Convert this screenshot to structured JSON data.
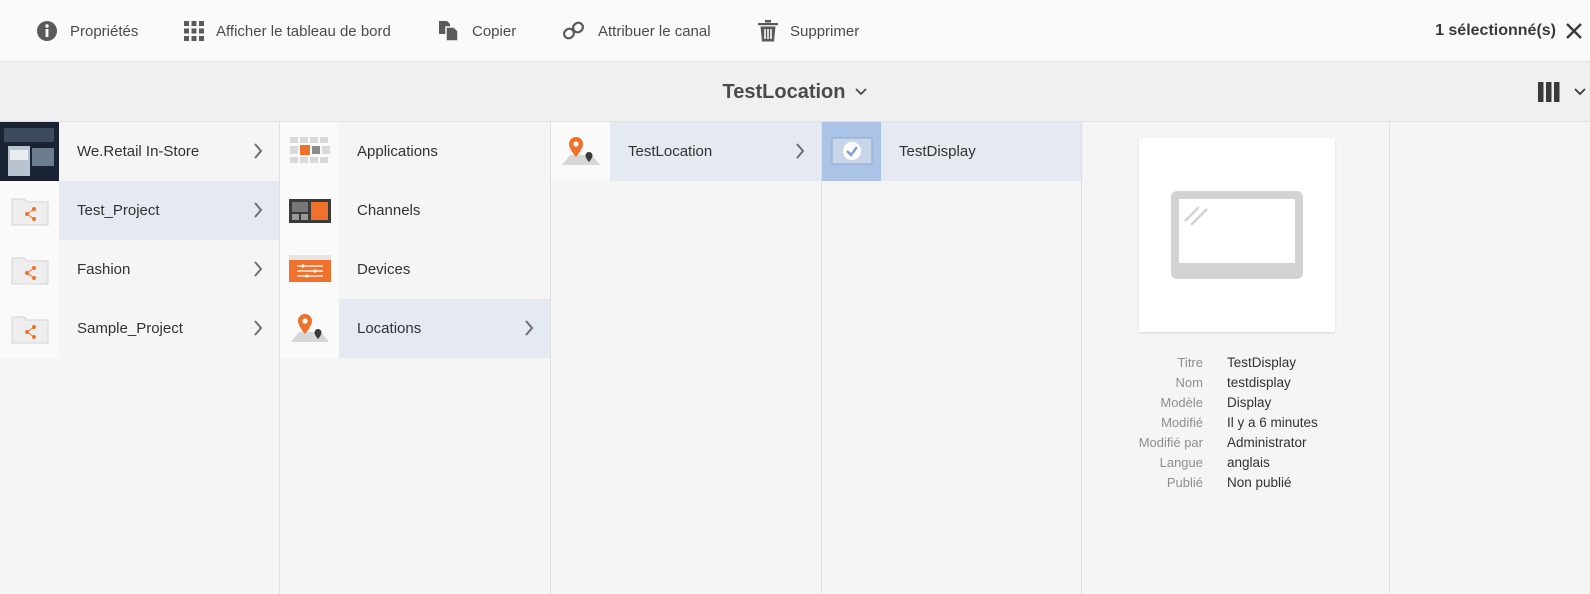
{
  "actions": [
    {
      "label": "Propriétés",
      "icon": "info-icon"
    },
    {
      "label": "Afficher le tableau de bord",
      "icon": "grid-icon"
    },
    {
      "label": "Copier",
      "icon": "copy-icon"
    },
    {
      "label": "Attribuer le canal",
      "icon": "link-icon"
    },
    {
      "label": "Supprimer",
      "icon": "trash-icon"
    }
  ],
  "selection": {
    "count_label": "1 sélectionné(s)"
  },
  "title": "TestLocation",
  "columns": {
    "projects": [
      {
        "name": "We.Retail In-Store",
        "icon": "image-thumbnail"
      },
      {
        "name": "Test_Project",
        "icon": "folder-share-icon"
      },
      {
        "name": "Fashion",
        "icon": "folder-share-icon"
      },
      {
        "name": "Sample_Project",
        "icon": "folder-share-icon"
      }
    ],
    "sections": [
      {
        "name": "Applications",
        "icon": "applications-icon"
      },
      {
        "name": "Channels",
        "icon": "channels-icon"
      },
      {
        "name": "Devices",
        "icon": "devices-icon"
      },
      {
        "name": "Locations",
        "icon": "location-pin-icon"
      }
    ],
    "locations": [
      {
        "name": "TestLocation",
        "icon": "location-pin-icon"
      }
    ],
    "displays": [
      {
        "name": "TestDisplay",
        "icon": "check-icon"
      }
    ]
  },
  "preview": {
    "icon": "display-icon",
    "meta": [
      {
        "key": "Titre",
        "value": "TestDisplay"
      },
      {
        "key": "Nom",
        "value": "testdisplay"
      },
      {
        "key": "Modèle",
        "value": "Display"
      },
      {
        "key": "Modifié",
        "value": "Il y a 6 minutes"
      },
      {
        "key": "Modifié par",
        "value": "Administrator"
      },
      {
        "key": "Langue",
        "value": "anglais"
      },
      {
        "key": "Publié",
        "value": "Non publié"
      }
    ]
  },
  "colors": {
    "accent_orange": "#f0712b",
    "selection_blue": "#abc3e6",
    "active_row": "#e5e9f2"
  }
}
